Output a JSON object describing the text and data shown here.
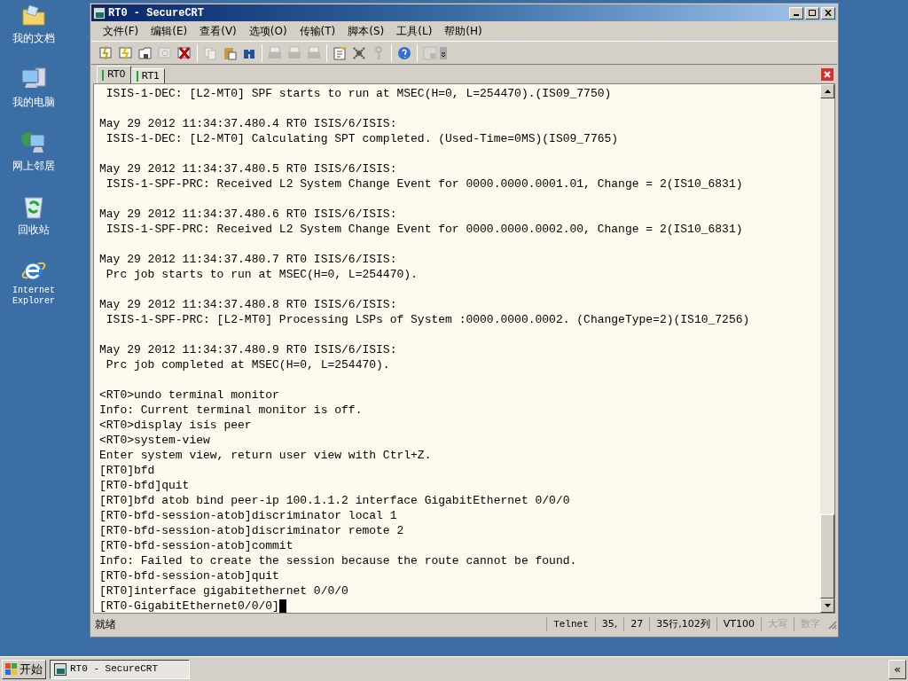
{
  "desktop_icons": [
    {
      "kind": "folder",
      "label": "我的文档"
    },
    {
      "kind": "computer",
      "label": "我的电脑"
    },
    {
      "kind": "network",
      "label": "网上邻居"
    },
    {
      "kind": "recycle",
      "label": "回收站"
    },
    {
      "kind": "browser",
      "label": "Internet Explorer"
    }
  ],
  "window": {
    "title": "RT0 - SecureCRT"
  },
  "menu": [
    "文件(F)",
    "编辑(E)",
    "查看(V)",
    "选项(O)",
    "传输(T)",
    "脚本(S)",
    "工具(L)",
    "帮助(H)"
  ],
  "toolbar": [
    {
      "kind": "connect"
    },
    {
      "kind": "quick-connect"
    },
    {
      "kind": "connect-tab"
    },
    {
      "kind": "reconnect",
      "disabled": true
    },
    {
      "kind": "disconnect"
    },
    {
      "kind": "separator"
    },
    {
      "kind": "copy",
      "disabled": true
    },
    {
      "kind": "paste"
    },
    {
      "kind": "find"
    },
    {
      "kind": "separator"
    },
    {
      "kind": "print-screen",
      "disabled": true
    },
    {
      "kind": "print-selection",
      "disabled": true
    },
    {
      "kind": "print",
      "disabled": true
    },
    {
      "kind": "separator"
    },
    {
      "kind": "session-options"
    },
    {
      "kind": "global-options"
    },
    {
      "kind": "keymap",
      "disabled": true
    },
    {
      "kind": "separator"
    },
    {
      "kind": "help"
    },
    {
      "kind": "separator"
    },
    {
      "kind": "sftp",
      "disabled": true
    }
  ],
  "tabs": [
    {
      "label": "RT0",
      "selected": true
    },
    {
      "label": "RT1",
      "selected": false
    }
  ],
  "terminal": {
    "blocks": [
      [
        " ISIS-1-DEC: [L2-MT0] SPF starts to run at MSEC(H=0, L=254470).(IS09_7750)"
      ],
      [
        "May 29 2012 11:34:37.480.4 RT0 ISIS/6/ISIS:",
        " ISIS-1-DEC: [L2-MT0] Calculating SPT completed. (Used-Time=0MS)(IS09_7765)"
      ],
      [
        "May 29 2012 11:34:37.480.5 RT0 ISIS/6/ISIS:",
        " ISIS-1-SPF-PRC: Received L2 System Change Event for 0000.0000.0001.01, Change = 2(IS10_6831)"
      ],
      [
        "May 29 2012 11:34:37.480.6 RT0 ISIS/6/ISIS:",
        " ISIS-1-SPF-PRC: Received L2 System Change Event for 0000.0000.0002.00, Change = 2(IS10_6831)"
      ],
      [
        "May 29 2012 11:34:37.480.7 RT0 ISIS/6/ISIS:",
        " Prc job starts to run at MSEC(H=0, L=254470)."
      ],
      [
        "May 29 2012 11:34:37.480.8 RT0 ISIS/6/ISIS:",
        " ISIS-1-SPF-PRC: [L2-MT0] Processing LSPs of System :0000.0000.0002. (ChangeType=2)(IS10_7256)"
      ],
      [
        "May 29 2012 11:34:37.480.9 RT0 ISIS/6/ISIS:",
        " Prc job completed at MSEC(H=0, L=254470)."
      ],
      [
        "<RT0>undo terminal monitor",
        "Info: Current terminal monitor is off.",
        "<RT0>display isis peer",
        "<RT0>system-view",
        "Enter system view, return user view with Ctrl+Z.",
        "[RT0]bfd",
        "[RT0-bfd]quit",
        "[RT0]bfd atob bind peer-ip 100.1.1.2 interface GigabitEthernet 0/0/0",
        "[RT0-bfd-session-atob]discriminator local 1",
        "[RT0-bfd-session-atob]discriminator remote 2",
        "[RT0-bfd-session-atob]commit",
        "Info: Failed to create the session because the route cannot be found.",
        "[RT0-bfd-session-atob]quit",
        "[RT0]interface gigabitethernet 0/0/0",
        "[RT0-GigabitEthernet0/0/0]"
      ]
    ]
  },
  "status_bar": {
    "message": "就绪",
    "panes": [
      {
        "text": "Telnet",
        "disabled": false
      },
      {
        "text": "35,",
        "disabled": false
      },
      {
        "text": "27",
        "disabled": false
      },
      {
        "text": "35行,102列",
        "disabled": false
      },
      {
        "text": "VT100",
        "disabled": false
      },
      {
        "text": "大写",
        "disabled": true
      },
      {
        "text": "数字",
        "disabled": true
      }
    ]
  },
  "taskbar": {
    "start": "开始",
    "tasks": [
      {
        "label": "RT0 - SecureCRT"
      }
    ],
    "expand": "«"
  }
}
